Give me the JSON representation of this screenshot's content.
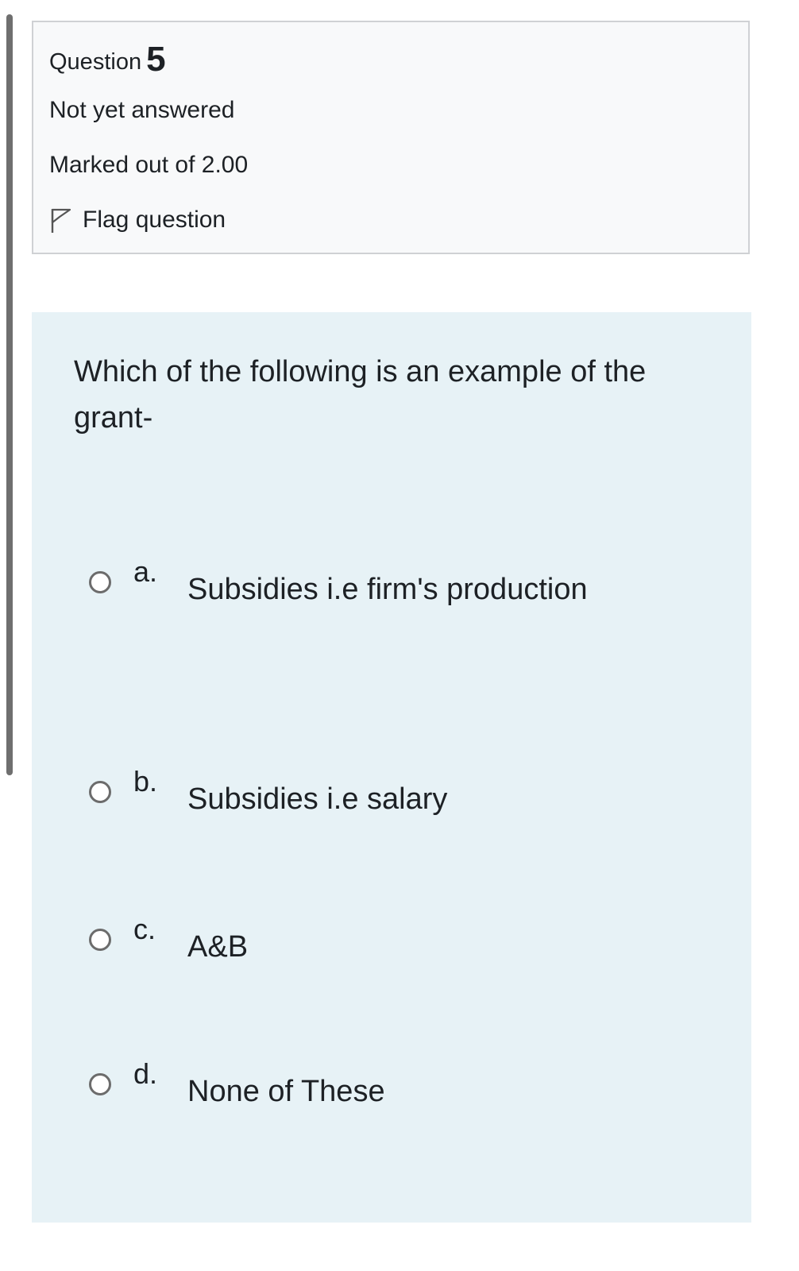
{
  "question": {
    "label": "Question",
    "number": "5",
    "state": "Not yet answered",
    "grade": "Marked out of 2.00",
    "flag_label": "Flag question",
    "text": "Which of the following is an example of the grant-"
  },
  "options": [
    {
      "letter": "a.",
      "text": "Subsidies i.e firm's production"
    },
    {
      "letter": "b.",
      "text": "Subsidies i.e salary"
    },
    {
      "letter": "c.",
      "text": "A&B"
    },
    {
      "letter": "d.",
      "text": "None of These"
    }
  ],
  "colors": {
    "info_background": "#f8f9fa",
    "content_background": "#e7f2f6",
    "border": "#cfd1d4",
    "text": "#1d2125"
  },
  "icons": {
    "flag": "flag-outline-icon"
  }
}
